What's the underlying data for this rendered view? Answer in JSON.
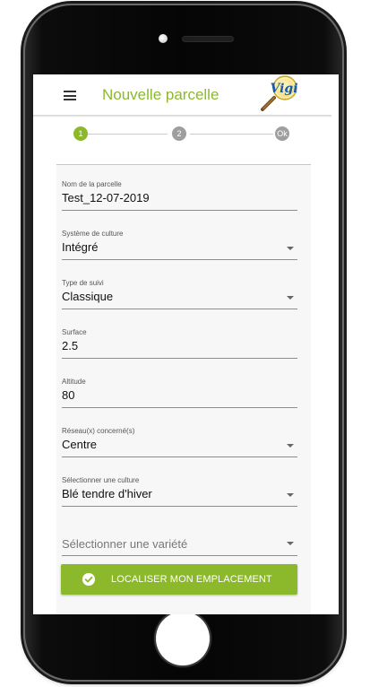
{
  "app": {
    "title": "Nouvelle parcelle",
    "logo_text": "Vigi",
    "brand_color": "#8cb92b"
  },
  "stepper": {
    "steps": [
      {
        "label": "1",
        "state": "active"
      },
      {
        "label": "2",
        "state": "inactive"
      },
      {
        "label": "Ok",
        "state": "inactive"
      }
    ]
  },
  "form": {
    "fields": [
      {
        "label": "Nom de la parcelle",
        "value": "Test_12-07-2019",
        "type": "text"
      },
      {
        "label": "Système de culture",
        "value": "Intégré",
        "type": "select"
      },
      {
        "label": "Type de suivi",
        "value": "Classique",
        "type": "select"
      },
      {
        "label": "Surface",
        "value": "2.5",
        "type": "text"
      },
      {
        "label": "Altitude",
        "value": "80",
        "type": "text"
      },
      {
        "label": "Réseau(x) concerné(s)",
        "value": "Centre",
        "type": "select"
      },
      {
        "label": "Sélectionner une culture",
        "value": "Blé tendre d'hiver",
        "type": "select"
      },
      {
        "label": "",
        "placeholder": "Sélectionner une variété",
        "value": "",
        "type": "select"
      }
    ]
  },
  "actions": {
    "locate_label": "LOCALISER MON EMPLACEMENT"
  }
}
